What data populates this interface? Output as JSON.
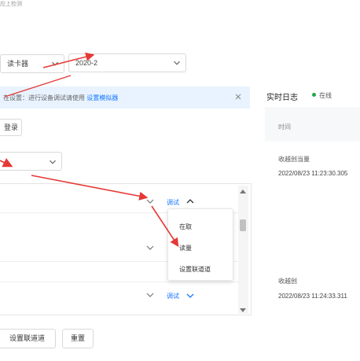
{
  "top_note": "应上检测",
  "colors": {
    "accent": "#1677ff",
    "arrow": "#e53935",
    "status_online": "#20a84b",
    "banner_bg": "#e8f3ff"
  },
  "selects": {
    "device_type": {
      "value": "读卡器",
      "icon": "chevron-down-icon"
    },
    "model": {
      "value": "2020-2",
      "icon": "chevron-down-icon"
    },
    "mode": {
      "value": "",
      "icon": "chevron-down-icon"
    }
  },
  "banner": {
    "text": "在设置：进行设备调试请使用",
    "link": "设置模拟器",
    "close_icon": "close-icon"
  },
  "small_button": "登录",
  "rows": [
    {
      "action": "调试",
      "expanded": true
    },
    {
      "action": "",
      "expanded": false
    },
    {
      "action": "调试",
      "expanded": false
    }
  ],
  "dropdown_menu": {
    "items": [
      "在取",
      "读量",
      "设置联道道"
    ]
  },
  "bottom_buttons": {
    "set_channel": "设置联道道",
    "reset": "重置"
  },
  "side_panel": {
    "title": "实时日志",
    "status": "在线",
    "column_header": "时间",
    "logs": [
      {
        "label": "收越创当量",
        "time": "2022/08/23 11:23:30.305"
      },
      {
        "label": "收越创",
        "time": "2022/08/23 11:24:33.311"
      }
    ]
  }
}
